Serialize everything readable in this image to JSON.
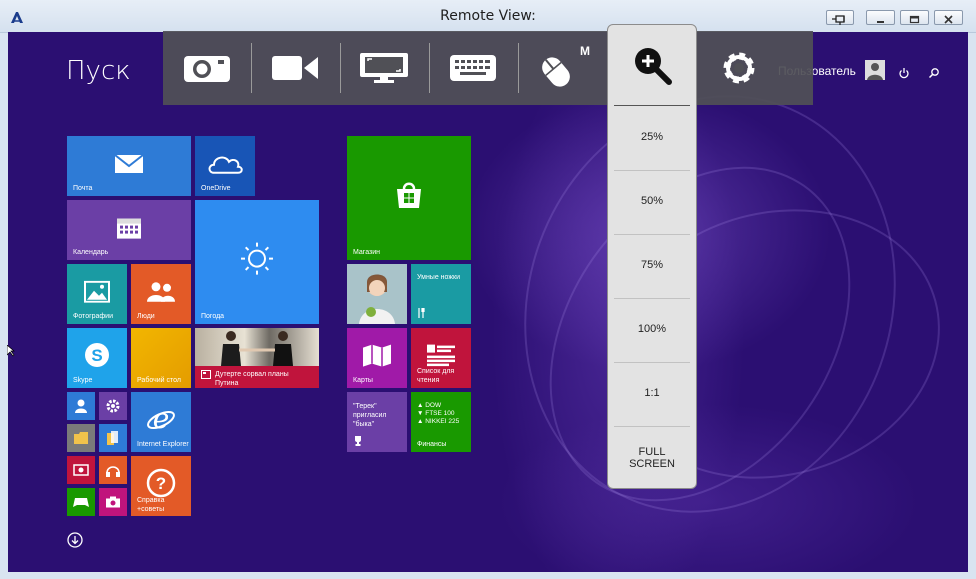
{
  "window": {
    "title": "Remote View:",
    "buttons": [
      "pin-icon",
      "minimize-icon",
      "restore-icon",
      "close-icon"
    ]
  },
  "start": {
    "title": "Пуск",
    "user_name": "Пользователь"
  },
  "tiles": {
    "mail": "Почта",
    "onedrive": "OneDrive",
    "calendar": "Календарь",
    "weather": "Погода",
    "photos": "Фотографии",
    "people": "Люди",
    "news_line1": "Дутерте сорвал планы",
    "news_line2": "Путина",
    "skype": "Skype",
    "desktop": "Рабочий стол",
    "ie": "Internet Explorer",
    "help_line1": "Справка",
    "help_line2": "+советы",
    "store": "Магазин",
    "recipes": "Умные ножки",
    "maps": "Карты",
    "reading_line1": "Список для",
    "reading_line2": "чтения",
    "sport_line1": "\"Терек\"",
    "sport_line2": "пригласил",
    "sport_line3": "\"быка\"",
    "finance": "Финансы",
    "ticker1": "▲ DOW",
    "ticker2": "▼ FTSE 100",
    "ticker3": "▲ NIKKEI 225"
  },
  "toolbar": {
    "items": [
      "camera-icon",
      "video-icon",
      "screen-icon",
      "keyboard-icon",
      "mouse-icon",
      "zoom-in-icon",
      "gear-icon"
    ],
    "mouse_badge": "M"
  },
  "zoom_menu": {
    "options": [
      "25%",
      "50%",
      "75%",
      "100%",
      "1:1"
    ],
    "full_line1": "FULL",
    "full_line2": "SCREEN"
  },
  "colors": {
    "background": "#2b0f72",
    "toolbar": "#505056",
    "tile_blue": "#2e7bd6",
    "tile_purple": "#6b3fa6",
    "tile_green": "#199900",
    "tile_orange": "#e35a27",
    "tile_red": "#c0143c",
    "tile_teal": "#1a9ba3"
  }
}
